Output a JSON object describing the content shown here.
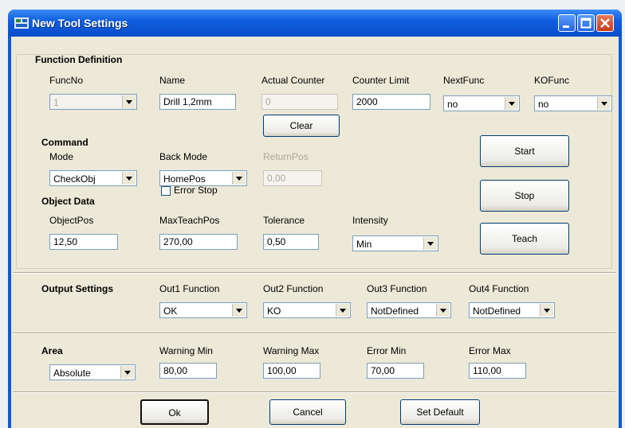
{
  "window": {
    "title": "New Tool Settings"
  },
  "sections": {
    "function_definition": "Function Definition",
    "command": "Command",
    "object_data": "Object Data",
    "output_settings": "Output Settings",
    "area": "Area"
  },
  "function_definition": {
    "funcno_label": "FuncNo",
    "funcno_value": "1",
    "name_label": "Name",
    "name_value": "Drill 1,2mm",
    "actual_counter_label": "Actual Counter",
    "actual_counter_value": "0",
    "counter_limit_label": "Counter Limit",
    "counter_limit_value": "2000",
    "nextfunc_label": "NextFunc",
    "nextfunc_value": "no",
    "kofunc_label": "KOFunc",
    "kofunc_value": "no",
    "clear_button": "Clear"
  },
  "command": {
    "mode_label": "Mode",
    "mode_value": "CheckObj",
    "back_mode_label": "Back Mode",
    "back_mode_value": "HomePos",
    "returnpos_label": "ReturnPos",
    "returnpos_value": "0,00",
    "error_stop_label": "Error Stop"
  },
  "object_data": {
    "objectpos_label": "ObjectPos",
    "objectpos_value": "12,50",
    "maxteachpos_label": "MaxTeachPos",
    "maxteachpos_value": "270,00",
    "tolerance_label": "Tolerance",
    "tolerance_value": "0,50",
    "intensity_label": "Intensity",
    "intensity_value": "Min"
  },
  "actions": {
    "start": "Start",
    "stop": "Stop",
    "teach": "Teach"
  },
  "output_settings": {
    "out1_label": "Out1 Function",
    "out1_value": "OK",
    "out2_label": "Out2 Function",
    "out2_value": "KO",
    "out3_label": "Out3 Function",
    "out3_value": "NotDefined",
    "out4_label": "Out4 Function",
    "out4_value": "NotDefined"
  },
  "area": {
    "mode_value": "Absolute",
    "warning_min_label": "Warning Min",
    "warning_min_value": "80,00",
    "warning_max_label": "Warning Max",
    "warning_max_value": "100,00",
    "error_min_label": "Error Min",
    "error_min_value": "70,00",
    "error_max_label": "Error Max",
    "error_max_value": "110,00"
  },
  "footer": {
    "ok": "Ok",
    "cancel": "Cancel",
    "set_default": "Set Default"
  }
}
